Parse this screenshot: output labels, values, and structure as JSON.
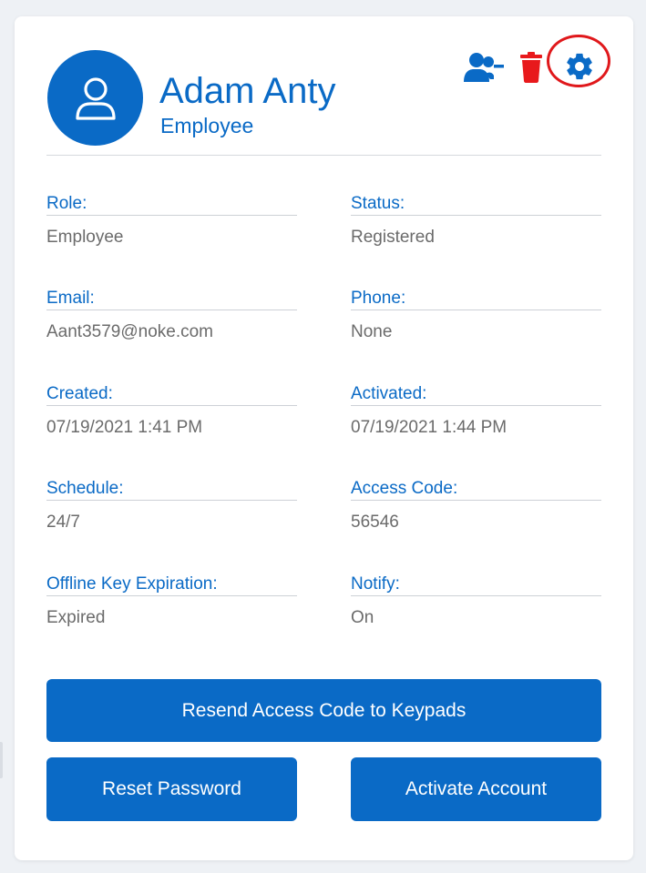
{
  "user": {
    "name": "Adam Anty",
    "subtitle": "Employee"
  },
  "actions": {
    "remove_user_icon": "user-minus-icon",
    "delete_icon": "trash-icon",
    "settings_icon": "gear-icon",
    "highlighted": "settings"
  },
  "fields": [
    {
      "label": "Role:",
      "value": "Employee"
    },
    {
      "label": "Status:",
      "value": "Registered"
    },
    {
      "label": "Email:",
      "value": "Aant3579@noke.com"
    },
    {
      "label": "Phone:",
      "value": "None"
    },
    {
      "label": "Created:",
      "value": "07/19/2021 1:41 PM"
    },
    {
      "label": "Activated:",
      "value": "07/19/2021 1:44 PM"
    },
    {
      "label": "Schedule:",
      "value": "24/7"
    },
    {
      "label": "Access Code:",
      "value": "56546"
    },
    {
      "label": "Offline Key Expiration:",
      "value": "Expired"
    },
    {
      "label": "Notify:",
      "value": "On"
    }
  ],
  "buttons": {
    "resend": "Resend Access Code to Keypads",
    "reset_password": "Reset Password",
    "activate_account": "Activate Account"
  },
  "colors": {
    "brand_blue": "#0a6ac6",
    "delete_red": "#e8191c",
    "highlight_red": "#e0181b"
  }
}
